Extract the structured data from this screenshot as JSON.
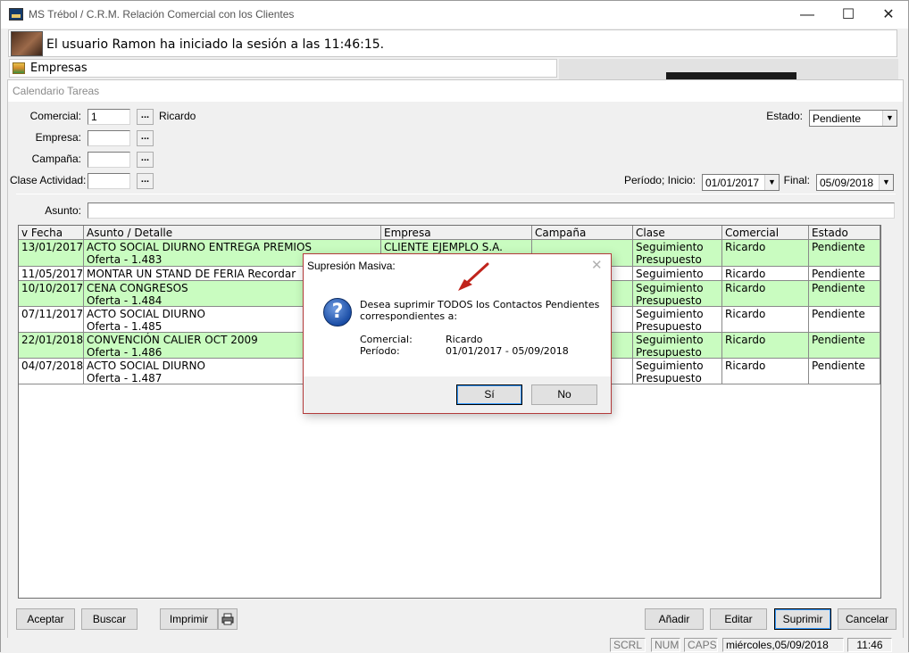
{
  "window": {
    "title": "MS Trébol / C.R.M. Relación Comercial con los  Clientes",
    "minimize": "—",
    "maximize": "☐",
    "close": "✕"
  },
  "session": {
    "message": "El usuario Ramon ha iniciado la sesión a las 11:46:15."
  },
  "empresas_tab": {
    "label": "Empresas"
  },
  "calendar": {
    "title": "Calendario Tareas",
    "labels": {
      "comercial": "Comercial:",
      "empresa": "Empresa:",
      "campana": "Campaña:",
      "clase_actividad": "Clase Actividad:",
      "asunto": "Asunto:",
      "estado": "Estado:",
      "periodo_inicio": "Período; Inicio:",
      "final": "Final:"
    },
    "values": {
      "comercial_code": "1",
      "comercial_name": "Ricardo",
      "empresa": "",
      "campana": "",
      "clase_actividad": "",
      "asunto": "",
      "estado": "Pendiente",
      "periodo_inicio": "01/01/2017",
      "final": "05/09/2018"
    },
    "dots": "..."
  },
  "grid": {
    "columns": [
      "v Fecha",
      "Asunto / Detalle",
      "Empresa",
      "Campaña",
      "Clase",
      "Comercial",
      "Estado"
    ],
    "rows": [
      {
        "fecha": "13/01/2017",
        "asunto": "ACTO SOCIAL DIURNO ENTREGA PREMIOS",
        "detalle": "Oferta - 1.483",
        "empresa": "CLIENTE EJEMPLO S.A.",
        "campana": "",
        "clase1": "Seguimiento",
        "clase2": "Presupuesto",
        "comercial": "Ricardo",
        "estado": "Pendiente"
      },
      {
        "fecha": "11/05/2017",
        "asunto": "MONTAR UN STAND DE FERIA Recordar",
        "detalle": "",
        "empresa": "",
        "campana": "",
        "clase1": "Seguimiento",
        "clase2": "",
        "comercial": "Ricardo",
        "estado": "Pendiente"
      },
      {
        "fecha": "10/10/2017",
        "asunto": "CENA CONGRESOS",
        "detalle": "Oferta - 1.484",
        "empresa": "",
        "campana": "",
        "clase1": "Seguimiento",
        "clase2": "Presupuesto",
        "comercial": "Ricardo",
        "estado": "Pendiente"
      },
      {
        "fecha": "07/11/2017",
        "asunto": "ACTO SOCIAL DIURNO",
        "detalle": "Oferta - 1.485",
        "empresa": "",
        "campana": "",
        "clase1": "Seguimiento",
        "clase2": "Presupuesto",
        "comercial": "Ricardo",
        "estado": "Pendiente"
      },
      {
        "fecha": "22/01/2018",
        "asunto": "CONVENCIÓN CALIER OCT 2009",
        "detalle": "Oferta - 1.486",
        "empresa": "",
        "campana": "",
        "clase1": "Seguimiento",
        "clase2": "Presupuesto",
        "comercial": "Ricardo",
        "estado": "Pendiente"
      },
      {
        "fecha": "04/07/2018",
        "asunto": "ACTO SOCIAL DIURNO",
        "detalle": "Oferta - 1.487",
        "empresa": "",
        "campana": "",
        "clase1": "Seguimiento",
        "clase2": "Presupuesto",
        "comercial": "Ricardo",
        "estado": "Pendiente"
      }
    ]
  },
  "buttons": {
    "aceptar": "Aceptar",
    "buscar": "Buscar",
    "imprimir": "Imprimir",
    "anadir": "Añadir",
    "editar": "Editar",
    "suprimir": "Suprimir",
    "cancelar": "Cancelar"
  },
  "statusbar": {
    "scrl": "SCRL",
    "num": "NUM",
    "caps": "CAPS",
    "date": "miércoles,05/09/2018",
    "time": "11:46"
  },
  "dialog": {
    "title": "Supresión Masiva:",
    "close": "✕",
    "message_line1": "Desea suprimir TODOS los Contactos Pendientes",
    "message_line2": "correspondientes a:",
    "comercial_label": "Comercial:",
    "comercial_value": "Ricardo",
    "periodo_label": "Período:",
    "periodo_value": "01/01/2017 - 05/09/2018",
    "yes": "Sí",
    "no": "No",
    "icon": "question-icon"
  },
  "colors": {
    "row_highlight": "#c9fcc0",
    "dialog_border": "#b33a3a",
    "annotation_arrow": "#c0241c"
  }
}
